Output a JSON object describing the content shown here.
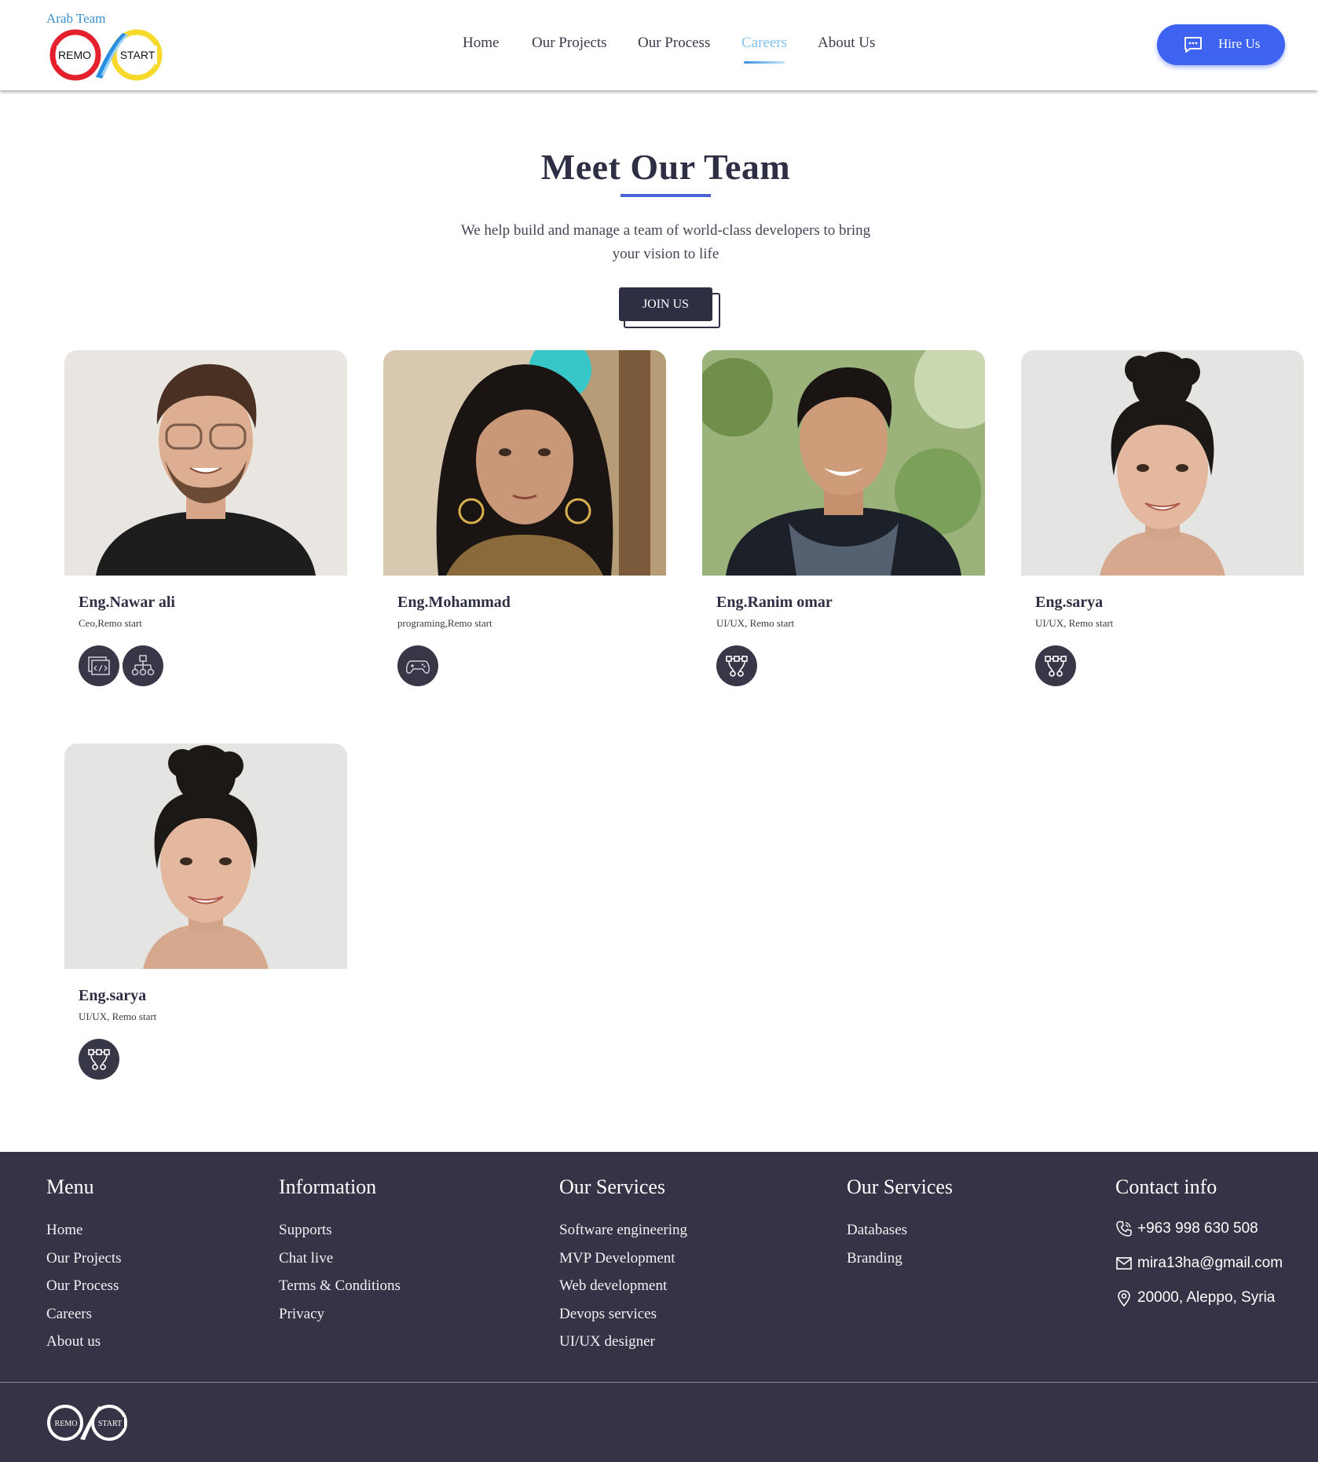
{
  "header": {
    "brand_sub": "Arab Team",
    "logo_left": "REMO",
    "logo_right": "START",
    "nav": [
      {
        "label": "Home",
        "active": false
      },
      {
        "label": "Our Projects",
        "active": false
      },
      {
        "label": "Our Process",
        "active": false
      },
      {
        "label": "Careers",
        "active": true
      },
      {
        "label": "About Us",
        "active": false
      }
    ],
    "hire_label": "Hire Us"
  },
  "hero": {
    "title": "Meet Our Team",
    "text_line1": "We help build and manage a team of world-class developers to bring",
    "text_line2": "your vision to life",
    "join_label": "JOIN US"
  },
  "team": [
    {
      "name": "Eng.Nawar ali",
      "role": "Ceo,Remo start",
      "skills": [
        "code-window-icon",
        "sitemap-icon"
      ]
    },
    {
      "name": "Eng.Mohammad",
      "role": "programing,Remo start",
      "skills": [
        "gamepad-icon"
      ]
    },
    {
      "name": "Eng.Ranim omar",
      "role": "UI/UX, Remo start",
      "skills": [
        "vector-nodes-icon"
      ]
    },
    {
      "name": "Eng.sarya",
      "role": "UI/UX, Remo start",
      "skills": [
        "vector-nodes-icon"
      ]
    },
    {
      "name": "Eng.sarya",
      "role": "UI/UX, Remo start",
      "skills": [
        "vector-nodes-icon"
      ]
    }
  ],
  "footer": {
    "menu": {
      "title": "Menu",
      "items": [
        "Home",
        "Our Projects",
        "Our Process",
        "Careers",
        "About us"
      ]
    },
    "information": {
      "title": "Information",
      "items": [
        "Supports",
        "Chat live",
        "Terms & Conditions",
        "Privacy"
      ]
    },
    "services1": {
      "title": "Our Services",
      "items": [
        "Software engineering",
        "MVP Development",
        "Web development",
        "Devops services",
        "UI/UX designer"
      ]
    },
    "services2": {
      "title": "Our Services",
      "items": [
        "Databases",
        "Branding"
      ]
    },
    "contact": {
      "title": "Contact info",
      "phone": "+963 998 630 508",
      "email": "mira13ha@gmail.com",
      "address": "20000, Aleppo, Syria"
    }
  },
  "colors": {
    "accent": "#3d63f0",
    "dark": "#343446",
    "nav_active": "#7fc0ef"
  }
}
